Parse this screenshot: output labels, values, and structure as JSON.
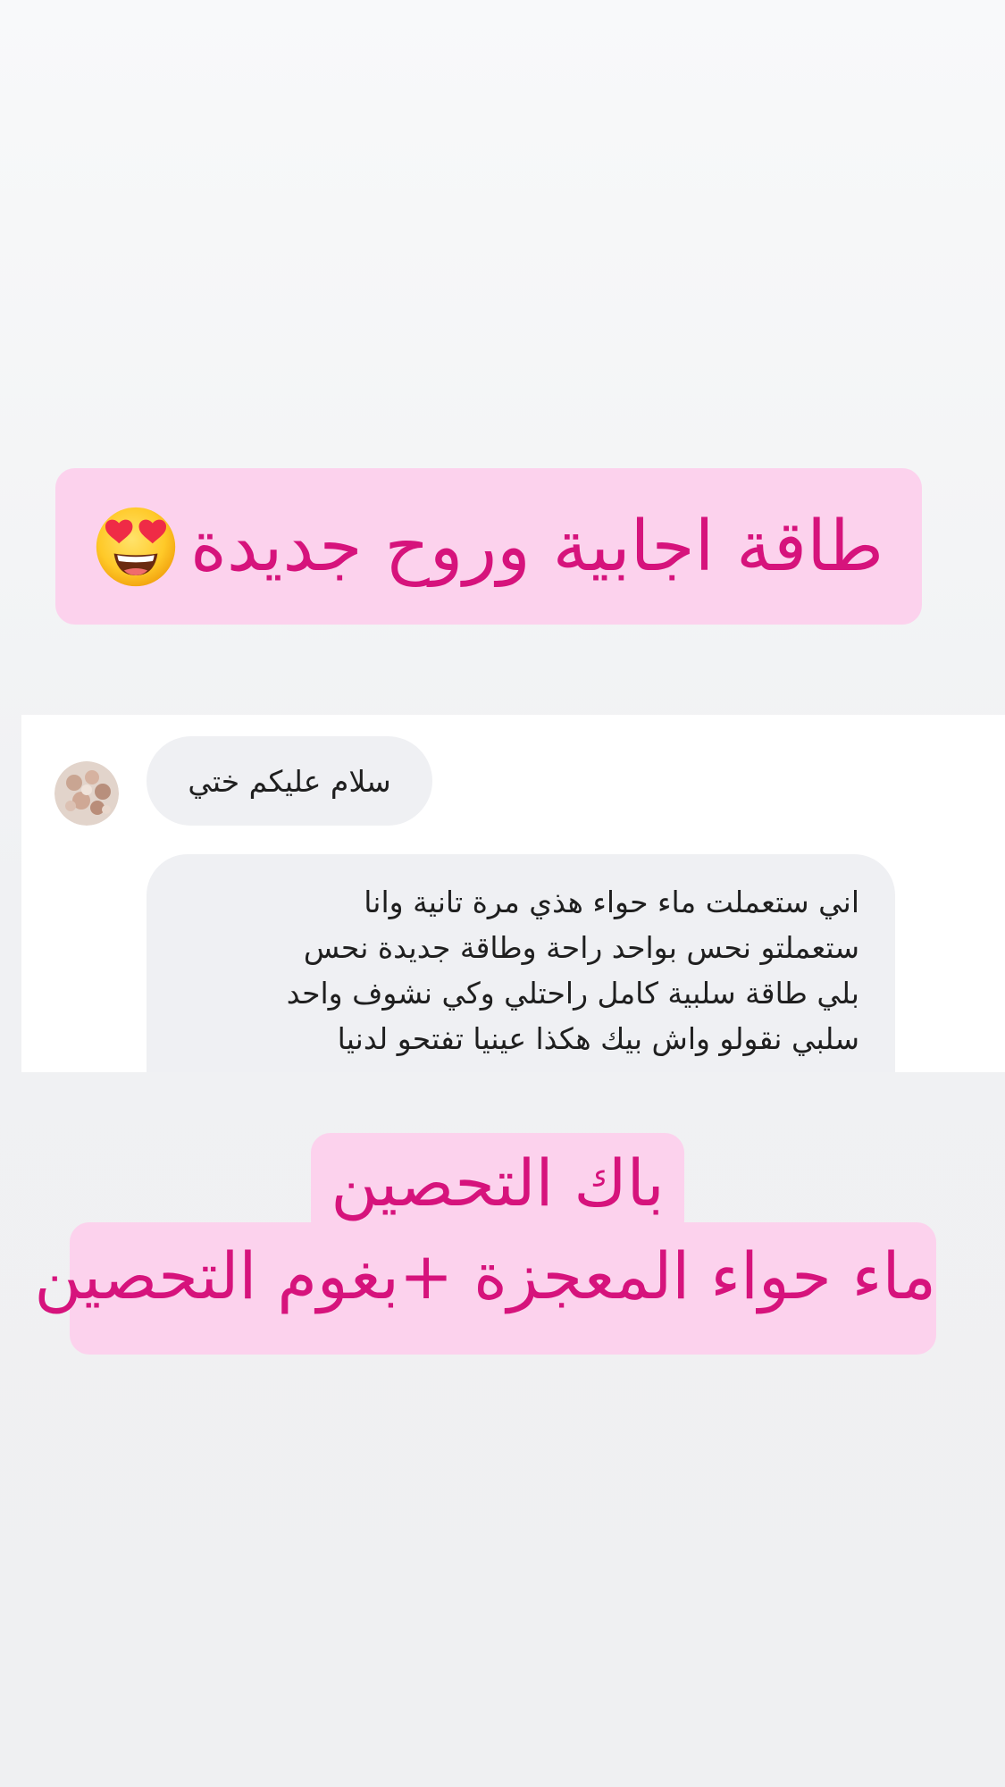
{
  "colors": {
    "banner_bg": "#fcd2ed",
    "banner_text": "#d6137c",
    "bubble_bg": "#eff0f3",
    "panel_bg": "#ffffff"
  },
  "headline": {
    "text": "طاقة اجابية وروح جديدة",
    "emoji": "smiling-face-with-heart-eyes"
  },
  "chat": {
    "messages": [
      {
        "lines": [
          "سلام عليكم ختي"
        ]
      },
      {
        "lines": [
          "اني ستعملت ماء حواء هذي مرة  تانية وانا",
          "ستعملتو نحس بواحد راحة وطاقة جديدة نحس",
          "بلي طاقة سلبية كامل راحتلي وكي نشوف واحد",
          "سلبي نقولو واش بيك هكذا عينيا تفتحو لدنيا"
        ]
      }
    ]
  },
  "offer": {
    "line1": "باك التحصين",
    "line2": "ماء حواء المعجزة +بغوم التحصين"
  }
}
